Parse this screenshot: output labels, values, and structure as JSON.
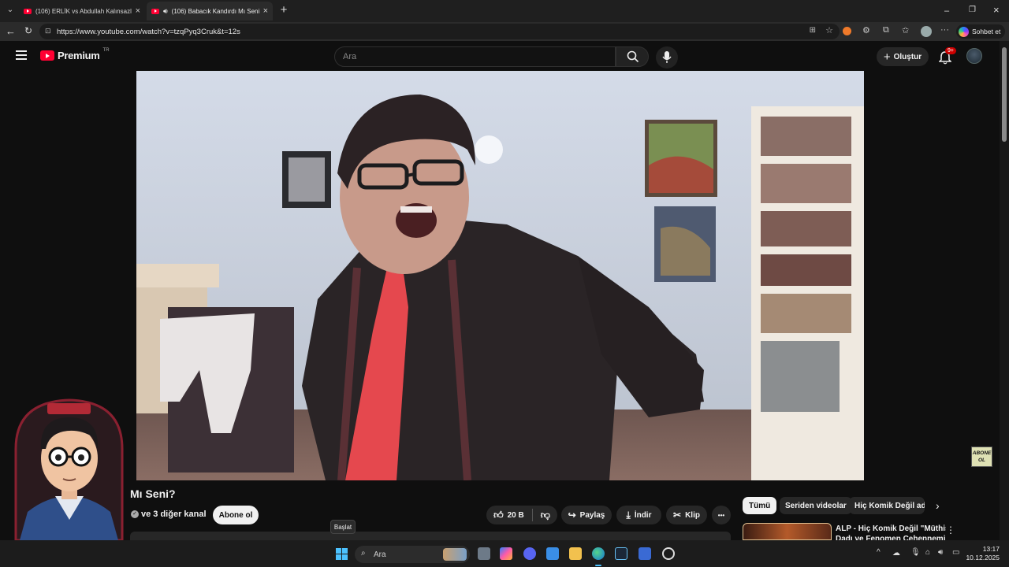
{
  "browser": {
    "tabs": [
      {
        "label": "(106) ERLİK vs Abdullah Kalınsazlı",
        "active": false
      },
      {
        "label": "(106) Babacık Kandırdı Mı Seni",
        "active": true
      }
    ],
    "new_tab": "+",
    "url": "https://www.youtube.com/watch?v=tzqPyq3Cruk&t=12s",
    "copilot_label": "Sohbet et"
  },
  "youtube": {
    "logo_text": "Premium",
    "logo_region": "TR",
    "search_placeholder": "Ara",
    "create_label": "Oluştur",
    "notif_count": "9+",
    "video_title": "Mı Seni?",
    "channel_text": "ve 3 diğer kanal",
    "subscribe_label": "Abone ol",
    "like_count": "20 B",
    "share_label": "Paylaş",
    "download_label": "İndir",
    "clip_label": "Klip",
    "more_label": "•••",
    "chips": [
      "Tümü",
      "Seriden videolar",
      "Hiç Komik Değil adlı y"
    ],
    "rec_title_line1": "ALP - Hiç Komik Değil \"Müthiş",
    "rec_title_line2": "Dadı ve Fenomen Cehennemi\"",
    "sticker_text_1": "ABONE",
    "sticker_text_2": "OL",
    "rec_menu": "⋮"
  },
  "taskbar": {
    "start_tooltip": "Başlat",
    "search_placeholder": "Ara",
    "time": "13:17",
    "date": "10.12.2025",
    "chevron": "^"
  },
  "colors": {
    "yt_red": "#ff0033",
    "accent_blue": "#3ea6ff"
  }
}
